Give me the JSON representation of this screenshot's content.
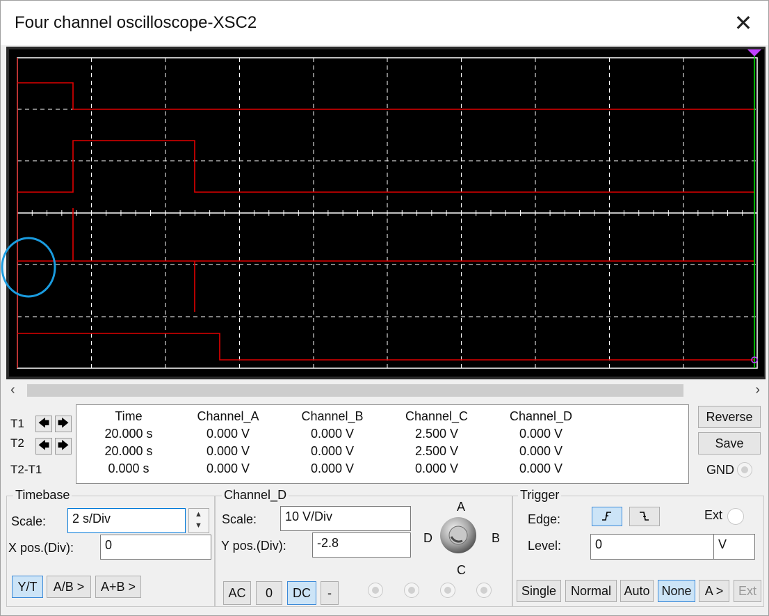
{
  "window": {
    "title": "Four channel oscilloscope-XSC2",
    "close_glyph": "✕"
  },
  "cursors": {
    "t1_label": "T1",
    "t2_label": "T2",
    "diff_label": "T2-T1",
    "left_glyph": "🡄",
    "right_glyph": "🡆"
  },
  "readout": {
    "columns": [
      {
        "header": "Time",
        "values": [
          "20.000 s",
          "20.000 s",
          "0.000 s"
        ]
      },
      {
        "header": "Channel_A",
        "values": [
          "0.000 V",
          "0.000 V",
          "0.000 V"
        ]
      },
      {
        "header": "Channel_B",
        "values": [
          "0.000 V",
          "0.000 V",
          "0.000 V"
        ]
      },
      {
        "header": "Channel_C",
        "values": [
          "2.500 V",
          "2.500 V",
          "0.000 V"
        ]
      },
      {
        "header": "Channel_D",
        "values": [
          "0.000 V",
          "0.000 V",
          "0.000 V"
        ]
      }
    ]
  },
  "side": {
    "reverse": "Reverse",
    "save": "Save",
    "gnd": "GND"
  },
  "timebase": {
    "title": "Timebase",
    "scale_label": "Scale:",
    "scale_value": "2  s/Div",
    "xpos_label": "X pos.(Div):",
    "xpos_value": "0",
    "yt": "Y/T",
    "ab": "A/B >",
    "apb": "A+B >"
  },
  "channel": {
    "title": "Channel_D",
    "scale_label": "Scale:",
    "scale_value": "10  V/Div",
    "ypos_label": "Y pos.(Div):",
    "ypos_value": "-2.8",
    "ac": "AC",
    "zero": "0",
    "dc": "DC",
    "minus": "-",
    "knob": {
      "a": "A",
      "b": "B",
      "c": "C",
      "d": "D"
    }
  },
  "trigger": {
    "title": "Trigger",
    "edge_label": "Edge:",
    "ext_label": "Ext",
    "level_label": "Level:",
    "level_value": "0",
    "level_unit": "V",
    "single": "Single",
    "normal": "Normal",
    "auto": "Auto",
    "none": "None",
    "a_gt": "A >",
    "ext_btn": "Ext"
  },
  "colors": {
    "trace": "#e00000",
    "grid": "#ffffff",
    "cursor": "#00e000",
    "annotation": "#1a9ce0"
  }
}
